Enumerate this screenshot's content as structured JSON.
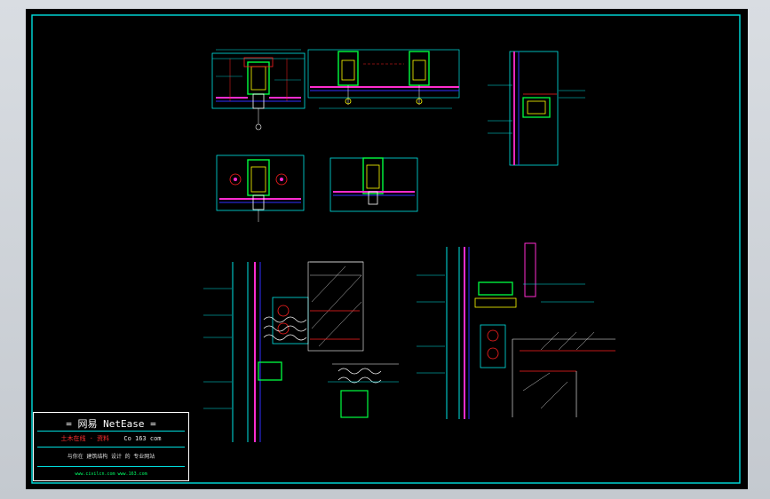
{
  "window": {
    "background": "#000000",
    "frame_color": "#00e0e0"
  },
  "title_block": {
    "brand": "= 网易 NetEase =",
    "subtitle_left": "土木在线 · 资料",
    "subtitle_right": "Co 163 com",
    "info": "与你在 建筑结构 设计 的 专业网站",
    "urls": "www.civilcn.com    www.163.com"
  },
  "palette": {
    "cyan": "#00e5e5",
    "green": "#00ff40",
    "magenta": "#ff2cd0",
    "red": "#ff2020",
    "yellow": "#ffff00",
    "white": "#ffffff",
    "blue": "#3030ff",
    "orange": "#ff8000",
    "brown": "#c06030"
  }
}
